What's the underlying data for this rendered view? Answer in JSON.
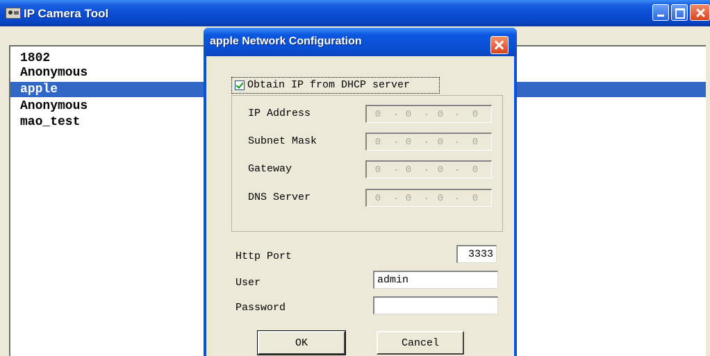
{
  "main_window": {
    "title": "IP Camera Tool",
    "devices": [
      {
        "name": "1802",
        "selected": false
      },
      {
        "name": "Anonymous",
        "selected": false
      },
      {
        "name": "apple",
        "selected": true
      },
      {
        "name": "Anonymous",
        "selected": false
      },
      {
        "name": "mao_test",
        "selected": false
      }
    ]
  },
  "dialog": {
    "title": "apple Network Configuration",
    "dhcp": {
      "label": "Obtain IP from DHCP server",
      "checked": true
    },
    "fields": [
      {
        "label": "IP Address",
        "octets": [
          "0",
          "0",
          "0",
          "0"
        ]
      },
      {
        "label": "Subnet Mask",
        "octets": [
          "0",
          "0",
          "0",
          "0"
        ]
      },
      {
        "label": "Gateway",
        "octets": [
          "0",
          "0",
          "0",
          "0"
        ]
      },
      {
        "label": "DNS Server",
        "octets": [
          "0",
          "0",
          "0",
          "0"
        ]
      }
    ],
    "http_port": {
      "label": "Http Port",
      "value": "3333"
    },
    "user": {
      "label": "User",
      "value": "admin"
    },
    "password": {
      "label": "Password",
      "value": ""
    },
    "ok_label": "OK",
    "cancel_label": "Cancel"
  }
}
